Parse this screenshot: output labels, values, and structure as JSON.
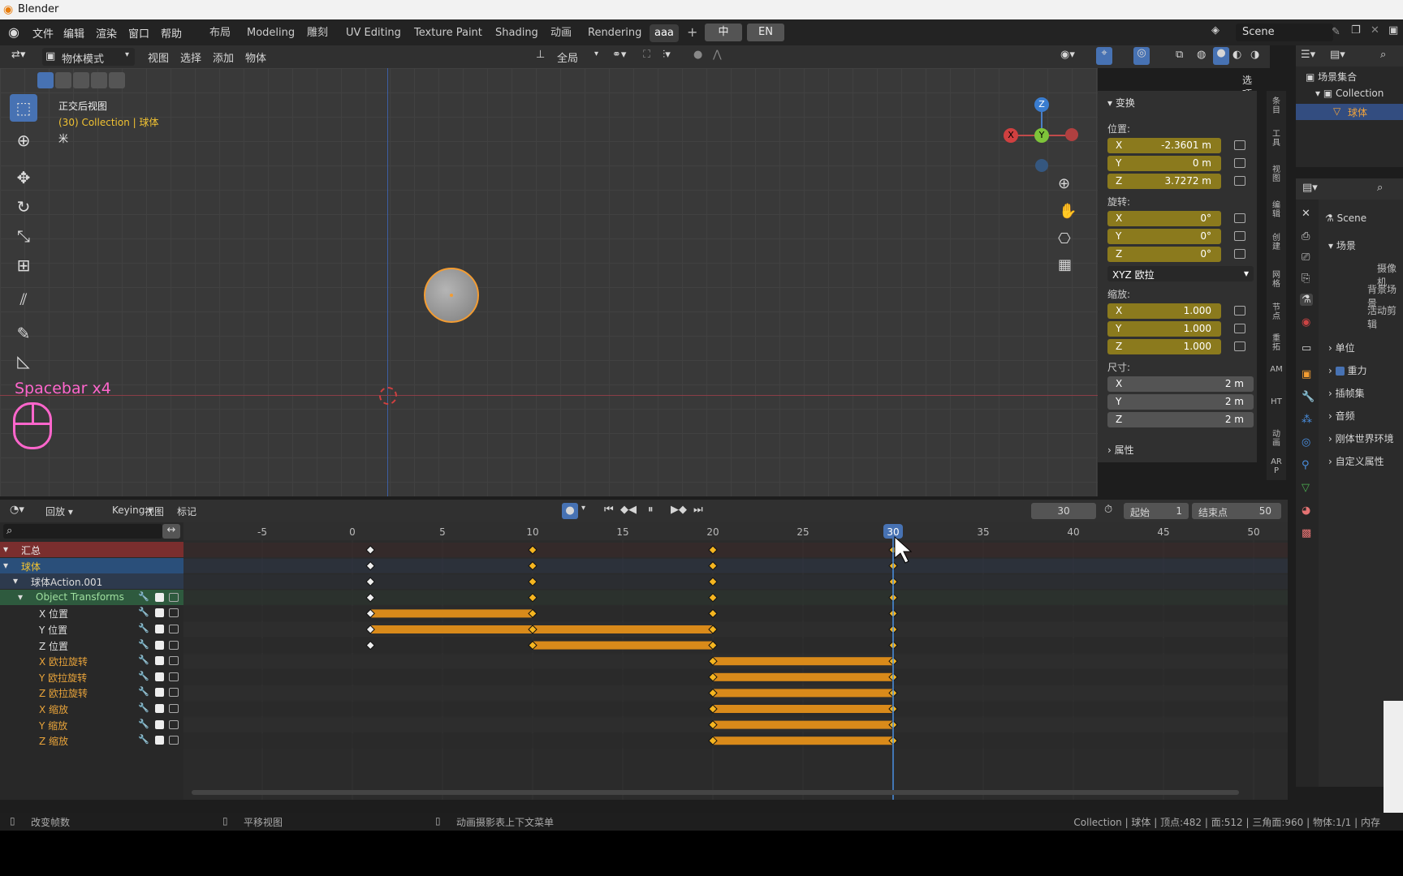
{
  "window": {
    "title": "Blender"
  },
  "menu": [
    "文件",
    "编辑",
    "渲染",
    "窗口",
    "帮助"
  ],
  "workspaces": [
    "布局",
    "Modeling",
    "雕刻",
    "UV Editing",
    "Texture Paint",
    "Shading",
    "动画",
    "Rendering",
    "aaa"
  ],
  "active_workspace": "aaa",
  "lang_buttons": [
    "中",
    "EN"
  ],
  "scene_name": "Scene",
  "viewport_header": {
    "mode": "物体模式",
    "menus": [
      "视图",
      "选择",
      "添加",
      "物体"
    ],
    "transform_orientation": "全局",
    "options": "选项"
  },
  "viewport_overlay": {
    "view_name": "正交后视图",
    "collection_line": "(30) Collection | 球体",
    "unit": "米",
    "screencast_text": "Spacebar x4"
  },
  "gizmo": {
    "x": "X",
    "y": "Y",
    "z": "Z"
  },
  "npanel": {
    "header": "变换",
    "location_label": "位置:",
    "location": [
      {
        "axis": "X",
        "value": "-2.3601 m"
      },
      {
        "axis": "Y",
        "value": "0 m"
      },
      {
        "axis": "Z",
        "value": "3.7272 m"
      }
    ],
    "rotation_label": "旋转:",
    "rotation": [
      {
        "axis": "X",
        "value": "0°"
      },
      {
        "axis": "Y",
        "value": "0°"
      },
      {
        "axis": "Z",
        "value": "0°"
      }
    ],
    "rotation_mode": "XYZ 欧拉",
    "scale_label": "缩放:",
    "scale": [
      {
        "axis": "X",
        "value": "1.000"
      },
      {
        "axis": "Y",
        "value": "1.000"
      },
      {
        "axis": "Z",
        "value": "1.000"
      }
    ],
    "dimensions_label": "尺寸:",
    "dimensions": [
      {
        "axis": "X",
        "value": "2 m"
      },
      {
        "axis": "Y",
        "value": "2 m"
      },
      {
        "axis": "Z",
        "value": "2 m"
      }
    ],
    "properties": "属性"
  },
  "sidebar_tabs": [
    "条目",
    "工具",
    "视图",
    "编辑",
    "创建",
    "网格",
    "节点",
    "重拓",
    "AM",
    "HT",
    "动画",
    "ARP"
  ],
  "outliner": {
    "root": "场景集合",
    "collection": "Collection",
    "object": "球体"
  },
  "properties": {
    "scene": "Scene",
    "section": "场景",
    "rows": [
      "摄像机",
      "背景场景",
      "活动剪辑"
    ],
    "panels": [
      "单位",
      "重力",
      "插帧集",
      "音频",
      "刚体世界环境",
      "自定义属性"
    ]
  },
  "timeline_header": {
    "menus": [
      "回放",
      "Keying",
      "视图",
      "标记"
    ],
    "current_frame": "30",
    "start_label": "起始",
    "start": "1",
    "end_label": "结束点",
    "end": "50"
  },
  "ruler": [
    "-5",
    "0",
    "5",
    "10",
    "15",
    "20",
    "25",
    "30",
    "35",
    "40",
    "45",
    "50"
  ],
  "channels": [
    {
      "name": "汇总",
      "color": "#7a2e2e",
      "text": "#eee"
    },
    {
      "name": "球体",
      "color": "#2a4f7a",
      "text": "#f1c232"
    },
    {
      "name": "球体Action.001",
      "color": "#2d3a4d",
      "text": "#ddd"
    },
    {
      "name": "Object Transforms",
      "color": "#2e5a3e",
      "text": "#9fe09f"
    },
    {
      "name": "X 位置",
      "color": "#282828",
      "text": "#ddd"
    },
    {
      "name": "Y 位置",
      "color": "#282828",
      "text": "#ddd"
    },
    {
      "name": "Z 位置",
      "color": "#282828",
      "text": "#ddd"
    },
    {
      "name": "X 欧拉旋转",
      "color": "#282828",
      "text": "#e8a33a"
    },
    {
      "name": "Y 欧拉旋转",
      "color": "#282828",
      "text": "#e8a33a"
    },
    {
      "name": "Z 欧拉旋转",
      "color": "#282828",
      "text": "#e8a33a"
    },
    {
      "name": "X 缩放",
      "color": "#282828",
      "text": "#e8a33a"
    },
    {
      "name": "Y 缩放",
      "color": "#282828",
      "text": "#e8a33a"
    },
    {
      "name": "Z 缩放",
      "color": "#282828",
      "text": "#e8a33a"
    }
  ],
  "keyframes": {
    "summary": [
      1,
      10,
      20,
      30
    ],
    "x_loc": [
      1,
      10,
      20,
      30
    ],
    "y_loc": [
      1,
      10,
      20,
      30
    ],
    "z_loc": [
      1,
      10,
      20,
      30
    ],
    "rot": [
      20,
      30
    ],
    "scale": [
      20,
      30
    ],
    "holds": [
      {
        "row": 4,
        "from": 1,
        "to": 10
      },
      {
        "row": 5,
        "from": 1,
        "to": 20
      },
      {
        "row": 6,
        "from": 10,
        "to": 20
      },
      {
        "row": 7,
        "from": 20,
        "to": 30
      },
      {
        "row": 8,
        "from": 20,
        "to": 30
      },
      {
        "row": 9,
        "from": 20,
        "to": 30
      },
      {
        "row": 10,
        "from": 20,
        "to": 30
      },
      {
        "row": 11,
        "from": 20,
        "to": 30
      },
      {
        "row": 12,
        "from": 20,
        "to": 30
      }
    ]
  },
  "statusbar": {
    "left1": "改变帧数",
    "left2": "平移视图",
    "left3": "动画摄影表上下文菜单",
    "right": "Collection | 球体 | 顶点:482 | 面:512 | 三角面:960 | 物体:1/1 | 内存"
  }
}
